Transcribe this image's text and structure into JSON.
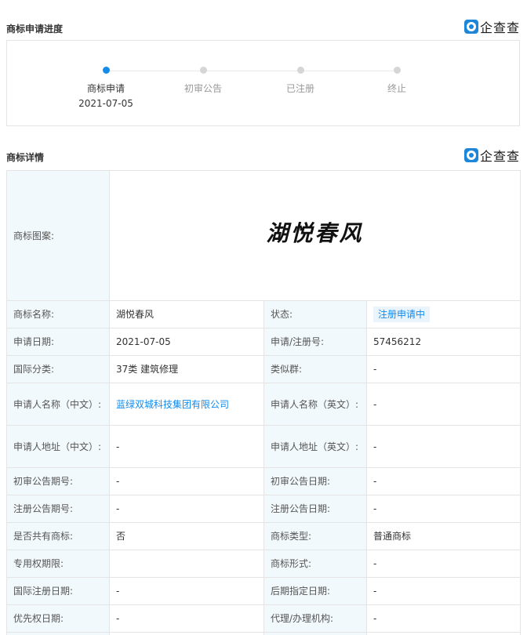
{
  "progress": {
    "title": "商标申请进度",
    "brand": "企查查",
    "steps": [
      {
        "label": "商标申请",
        "date": "2021-07-05"
      },
      {
        "label": "初审公告"
      },
      {
        "label": "已注册"
      },
      {
        "label": "终止"
      }
    ]
  },
  "details": {
    "title": "商标详情",
    "brand": "企查查",
    "image_label": "商标图案:",
    "image_text": "湖悦春风",
    "rows": [
      {
        "l1": "商标名称:",
        "v1": "湖悦春风",
        "l2": "状态:",
        "v2": "注册申请中"
      },
      {
        "l1": "申请日期:",
        "v1": "2021-07-05",
        "l2": "申请/注册号:",
        "v2": "57456212"
      },
      {
        "l1": "国际分类:",
        "v1": "37类 建筑修理",
        "l2": "类似群:",
        "v2": "-"
      },
      {
        "l1": "申请人名称（中文）:",
        "v1": "蓝绿双城科技集团有限公司",
        "l2": "申请人名称（英文）:",
        "v2": "-"
      },
      {
        "l1": "申请人地址（中文）:",
        "v1": "-",
        "l2": "申请人地址（英文）:",
        "v2": "-"
      },
      {
        "l1": "初审公告期号:",
        "v1": "-",
        "l2": "初审公告日期:",
        "v2": "-"
      },
      {
        "l1": "注册公告期号:",
        "v1": "-",
        "l2": "注册公告日期:",
        "v2": "-"
      },
      {
        "l1": "是否共有商标:",
        "v1": "否",
        "l2": "商标类型:",
        "v2": "普通商标"
      },
      {
        "l1": "专用权期限:",
        "v1": "",
        "l2": "商标形式:",
        "v2": "-"
      },
      {
        "l1": "国际注册日期:",
        "v1": "-",
        "l2": "后期指定日期:",
        "v2": "-"
      },
      {
        "l1": "优先权日期:",
        "v1": "-",
        "l2": "代理/办理机构:",
        "v2": "-"
      }
    ]
  }
}
